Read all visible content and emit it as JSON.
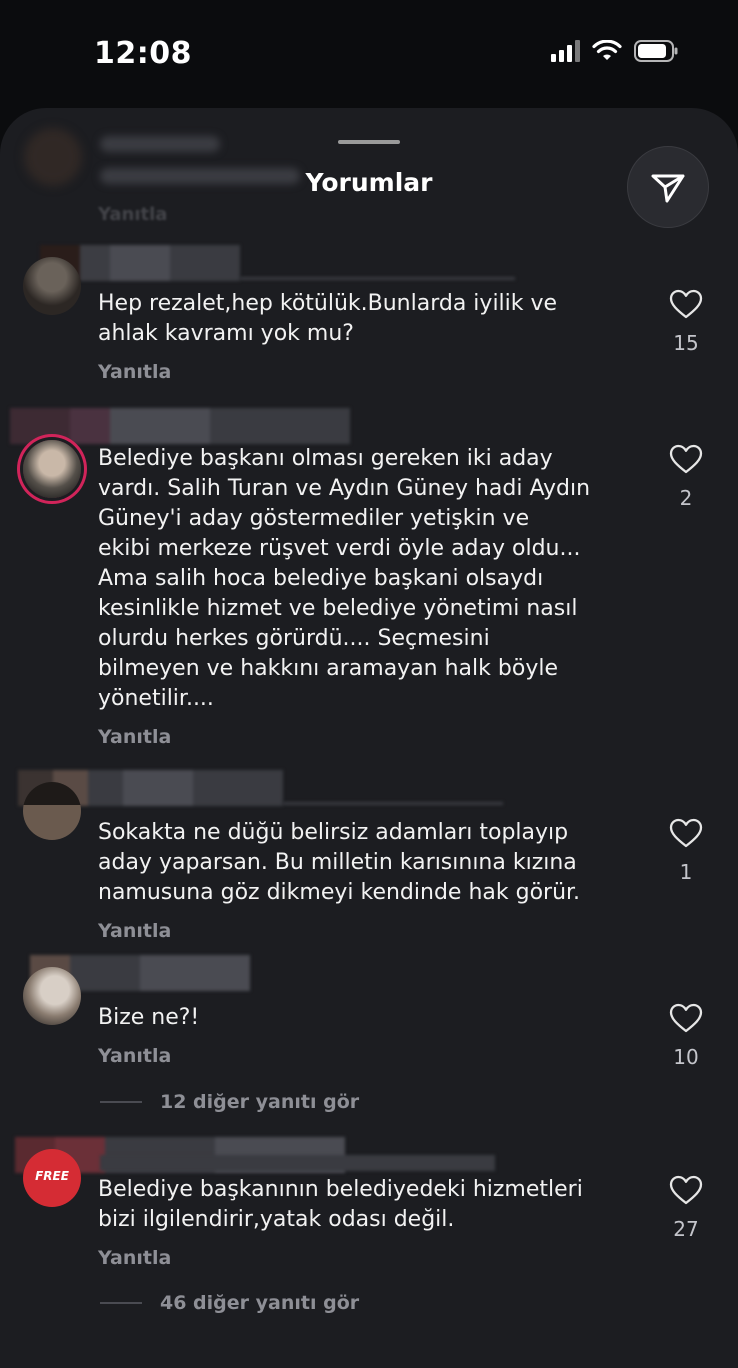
{
  "status_bar": {
    "time": "12:08"
  },
  "sheet": {
    "title": "Yorumlar",
    "share_icon": "paper-plane-icon"
  },
  "partial_comment": {
    "reply_label": "Yanıtla"
  },
  "comments": [
    {
      "text": "Hep rezalet,hep kötülük.Bunlarda iyilik ve\nahlak kavramı yok mu?",
      "reply_label": "Yanıtla",
      "likes": "15"
    },
    {
      "text": "Belediye başkanı olması gereken iki aday\nvardı. Salih Turan ve Aydın Güney hadi Aydın\nGüney'i  aday göstermediler yetişkin ve\nekibi merkeze rüşvet verdi öyle aday oldu...\nAma salih hoca belediye başkani olsaydı\nkesinlikle hizmet ve belediye yönetimi nasıl\nolurdu herkes görürdü.... Seçmesini\nbilmeyen ve hakkını aramayan halk böyle\nyönetilir....",
      "reply_label": "Yanıtla",
      "likes": "2"
    },
    {
      "text": "Sokakta ne düğü belirsiz adamları toplayıp\naday yaparsan. Bu milletin karısınına kızına\nnamusuna göz dikmeyi kendinde hak görür.",
      "reply_label": "Yanıtla",
      "likes": "1"
    },
    {
      "text": "Bize ne?!",
      "reply_label": "Yanıtla",
      "likes": "10",
      "more_replies": "12 diğer yanıtı gör"
    },
    {
      "text": "Belediye başkanının belediyedeki hizmetleri\nbizi ilgilendirir,yatak odası değil.",
      "reply_label": "Yanıtla",
      "likes": "27",
      "more_replies": "46 diğer yanıtı gör",
      "avatar_text": "FREE"
    }
  ],
  "colors": {
    "background": "#0b0c0e",
    "sheet": "#1c1d21",
    "text": "#f2f2f2",
    "muted": "#8e8f96",
    "story_ring": "#d1245a"
  }
}
